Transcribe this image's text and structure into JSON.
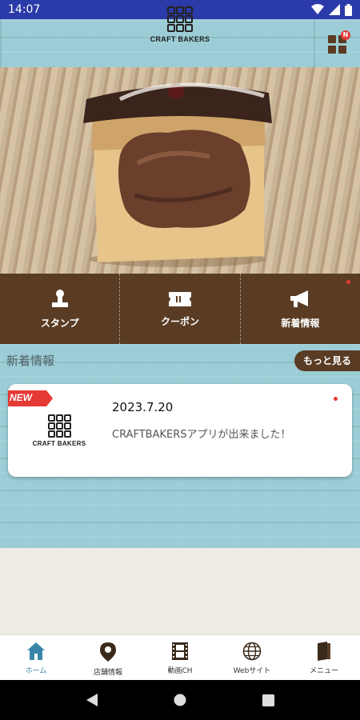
{
  "status_bar": {
    "time": "14:07",
    "icons": [
      "wifi-icon",
      "signal-icon",
      "battery-icon"
    ]
  },
  "header": {
    "logo_text": "CRAFT BAKERS",
    "menu_badge": "N"
  },
  "quick_nav": [
    {
      "label": "スタンプ",
      "icon": "stamp-icon"
    },
    {
      "label": "クーポン",
      "icon": "coupon-icon"
    },
    {
      "label": "新着情報",
      "icon": "megaphone-icon"
    }
  ],
  "news": {
    "title": "新着情報",
    "more_label": "もっと見る",
    "items": [
      {
        "badge": "NEW",
        "logo_text": "CRAFT BAKERS",
        "date": "2023.7.20",
        "text": "CRAFTBAKERSアプリが出来ました！"
      }
    ]
  },
  "tabs": [
    {
      "label": "ホーム",
      "icon": "home-icon",
      "active": true
    },
    {
      "label": "店舗情報",
      "icon": "location-pin-icon",
      "active": false
    },
    {
      "label": "動画CH",
      "icon": "film-icon",
      "active": false
    },
    {
      "label": "Webサイト",
      "icon": "globe-icon",
      "active": false
    },
    {
      "label": "メニュー",
      "icon": "book-icon",
      "active": false
    }
  ],
  "colors": {
    "status_bar": "#2a3aa8",
    "brown": "#5a3c24",
    "wood": "#9ccdd6",
    "accent_blue": "#3a86a8",
    "badge_red": "#e53935"
  }
}
